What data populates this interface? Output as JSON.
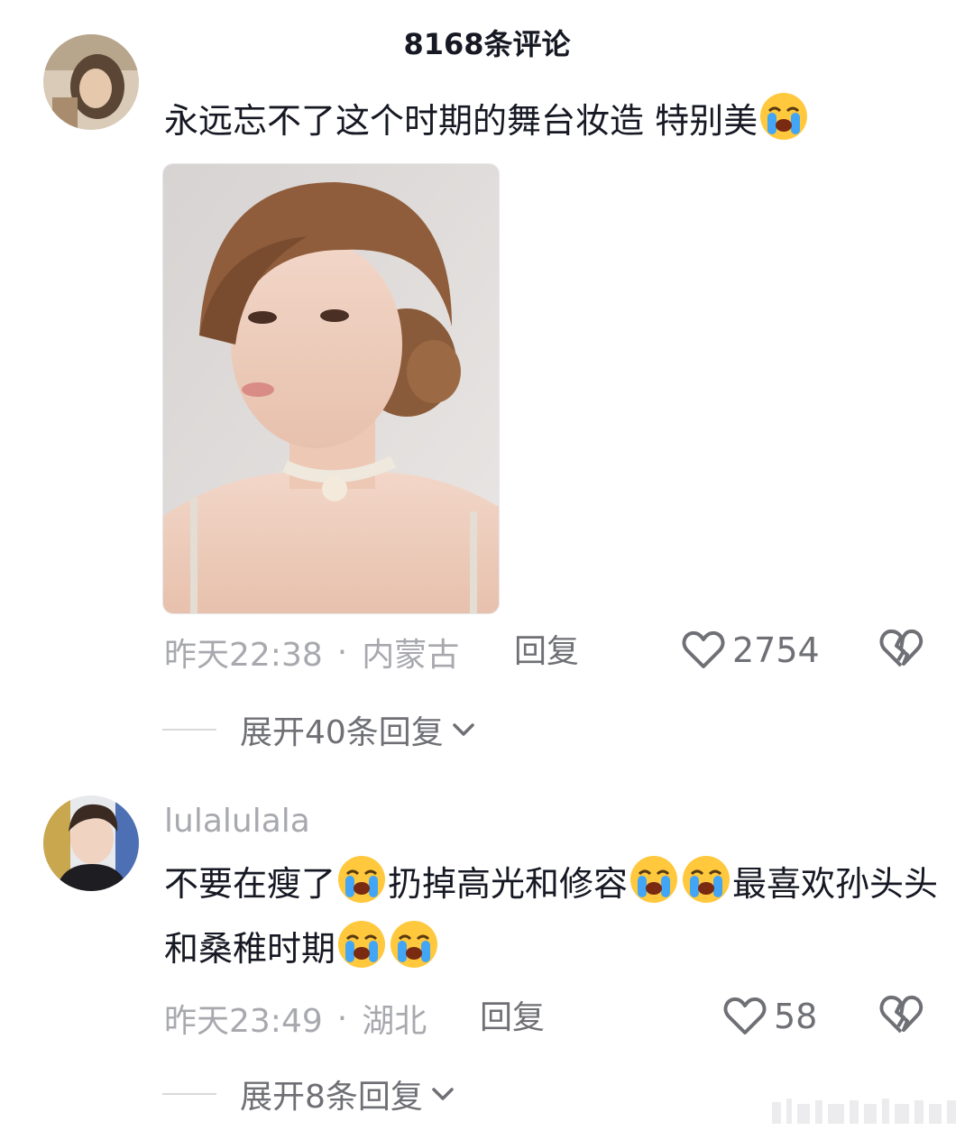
{
  "header": {
    "title": "8168条评论"
  },
  "comments": [
    {
      "text_parts": [
        "永远忘不了这个时期的舞台妆造 特别美"
      ],
      "emoji_name": "loudly-crying-face-emoji",
      "time": "昨天22:38",
      "separator": "·",
      "location": "内蒙古",
      "reply_label": "回复",
      "likes": "2754",
      "expand_label": "展开40条回复"
    },
    {
      "username": "lulalulala",
      "text_parts": [
        "不要在瘦了",
        "扔掉高光和修容",
        "最喜欢孙头头和桑稚时期"
      ],
      "time": "昨天23:49",
      "separator": "·",
      "location": "湖北",
      "reply_label": "回复",
      "likes": "58",
      "expand_label": "展开8条回复"
    }
  ],
  "colors": {
    "primary_text": "#161823",
    "secondary_text": "#a8a9ae",
    "action_text": "#6f7075"
  }
}
